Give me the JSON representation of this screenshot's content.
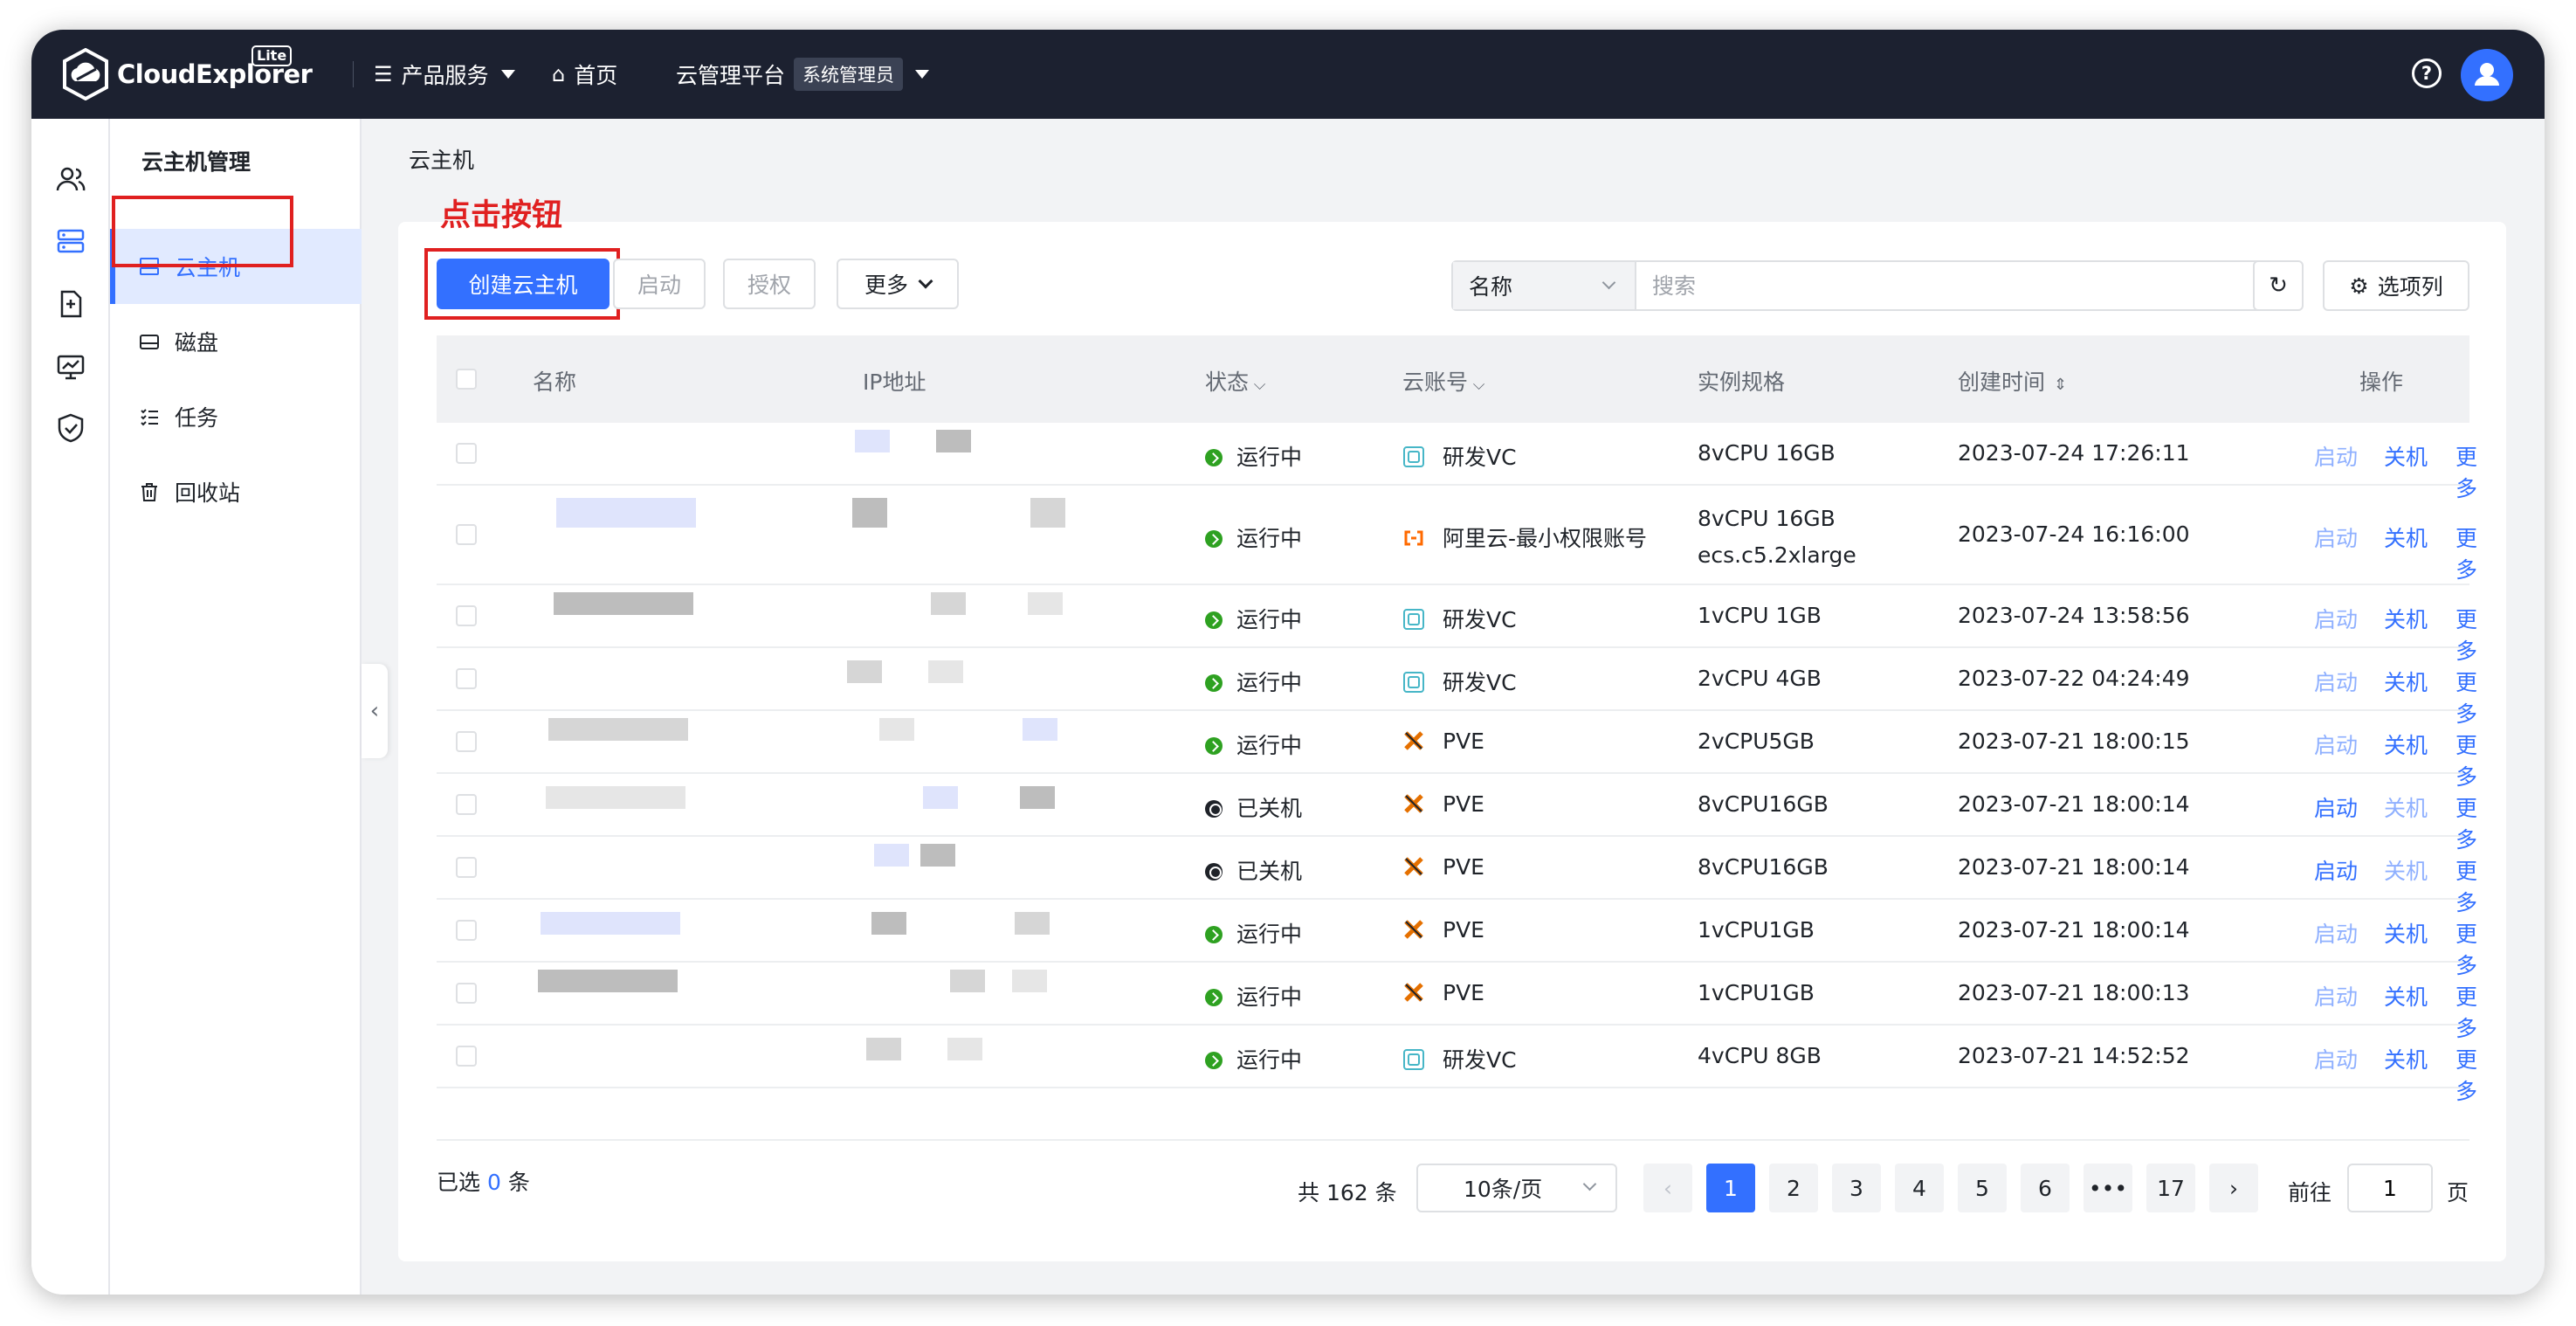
{
  "app": {
    "logo_text": "CloudExplorer",
    "edition_badge": "Lite",
    "nav": {
      "products_label": "产品服务",
      "home_label": "首页",
      "platform_label": "云管理平台",
      "role_badge": "系统管理员"
    }
  },
  "sidebar": {
    "title": "云主机管理",
    "items": [
      {
        "label": "云主机",
        "icon": "server-icon",
        "active": true
      },
      {
        "label": "磁盘",
        "icon": "disk-icon"
      },
      {
        "label": "任务",
        "icon": "task-list-icon"
      },
      {
        "label": "回收站",
        "icon": "trash-icon"
      }
    ]
  },
  "breadcrumb": "云主机",
  "annotation": "点击按钮",
  "toolbar": {
    "create_label": "创建云主机",
    "start_label": "启动",
    "grant_label": "授权",
    "more_label": "更多",
    "search_field": "名称",
    "search_placeholder": "搜索",
    "columns_label": "选项列"
  },
  "table": {
    "headers": {
      "name": "名称",
      "ip": "IP地址",
      "status": "状态",
      "account": "云账号",
      "spec": "实例规格",
      "created": "创建时间",
      "actions": "操作"
    },
    "rows": [
      {
        "status": "运行中",
        "state": "running",
        "account": "研发VC",
        "provider": "vsphere",
        "spec": "8vCPU 16GB",
        "spec2": "",
        "created": "2023-07-24 17:26:11"
      },
      {
        "status": "运行中",
        "state": "running",
        "account": "阿里云-最小权限账号",
        "provider": "aliyun",
        "spec": "8vCPU 16GB",
        "spec2": "ecs.c5.2xlarge",
        "created": "2023-07-24 16:16:00"
      },
      {
        "status": "运行中",
        "state": "running",
        "account": "研发VC",
        "provider": "vsphere",
        "spec": "1vCPU 1GB",
        "spec2": "",
        "created": "2023-07-24 13:58:56"
      },
      {
        "status": "运行中",
        "state": "running",
        "account": "研发VC",
        "provider": "vsphere",
        "spec": "2vCPU 4GB",
        "spec2": "",
        "created": "2023-07-22 04:24:49"
      },
      {
        "status": "运行中",
        "state": "running",
        "account": "PVE",
        "provider": "proxmox",
        "spec": "2vCPU5GB",
        "spec2": "",
        "created": "2023-07-21 18:00:15"
      },
      {
        "status": "已关机",
        "state": "stopped",
        "account": "PVE",
        "provider": "proxmox",
        "spec": "8vCPU16GB",
        "spec2": "",
        "created": "2023-07-21 18:00:14"
      },
      {
        "status": "已关机",
        "state": "stopped",
        "account": "PVE",
        "provider": "proxmox",
        "spec": "8vCPU16GB",
        "spec2": "",
        "created": "2023-07-21 18:00:14"
      },
      {
        "status": "运行中",
        "state": "running",
        "account": "PVE",
        "provider": "proxmox",
        "spec": "1vCPU1GB",
        "spec2": "",
        "created": "2023-07-21 18:00:14"
      },
      {
        "status": "运行中",
        "state": "running",
        "account": "PVE",
        "provider": "proxmox",
        "spec": "1vCPU1GB",
        "spec2": "",
        "created": "2023-07-21 18:00:13"
      },
      {
        "status": "运行中",
        "state": "running",
        "account": "研发VC",
        "provider": "vsphere",
        "spec": "4vCPU 8GB",
        "spec2": "",
        "created": "2023-07-21 14:52:52"
      }
    ],
    "row_actions": {
      "start": "启动",
      "shutdown": "关机",
      "more": "更多"
    }
  },
  "footer": {
    "selected_prefix": "已选",
    "selected_count": "0",
    "selected_suffix": "条",
    "total_text": "共 162 条",
    "page_size": "10条/页",
    "pages": [
      "1",
      "2",
      "3",
      "4",
      "5",
      "6",
      "•••",
      "17"
    ],
    "current_page": "1",
    "goto_prefix": "前往",
    "goto_value": "1",
    "goto_suffix": "页"
  },
  "colors": {
    "accent": "#3370ff",
    "topbar": "#1c2130",
    "running": "#2ea121",
    "annotation": "#e02020"
  }
}
